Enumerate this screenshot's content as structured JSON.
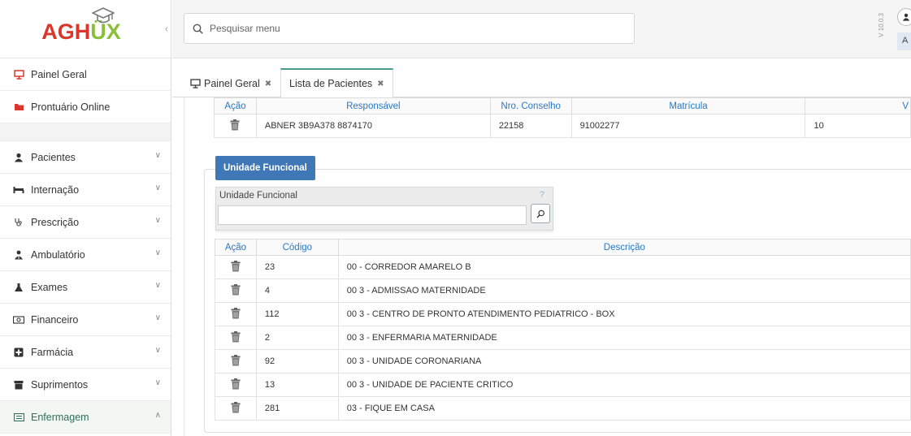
{
  "app": {
    "logo_text_a": "AGH",
    "logo_text_ux": "ÜX"
  },
  "sidebar": {
    "collapse_icon": "chevron-left-icon",
    "top_items": [
      {
        "label": "Painel Geral",
        "icon": "monitor-icon",
        "color": "#d9372b"
      },
      {
        "label": "Prontuário Online",
        "icon": "folder-icon",
        "color": "#d9372b"
      }
    ],
    "items": [
      {
        "label": "Pacientes",
        "icon": "user-icon"
      },
      {
        "label": "Internação",
        "icon": "bed-icon"
      },
      {
        "label": "Prescrição",
        "icon": "stethoscope-icon"
      },
      {
        "label": "Ambulatório",
        "icon": "doctor-icon"
      },
      {
        "label": "Exames",
        "icon": "flask-icon"
      },
      {
        "label": "Financeiro",
        "icon": "money-icon"
      },
      {
        "label": "Farmácia",
        "icon": "pharmacy-icon"
      },
      {
        "label": "Suprimentos",
        "icon": "box-icon"
      },
      {
        "label": "Enfermagem",
        "icon": "card-icon",
        "active": true
      }
    ]
  },
  "topbar": {
    "search_placeholder": "Pesquisar menu",
    "version": "V 10.0.3",
    "user_initial": "A"
  },
  "tabs": [
    {
      "label": "Painel Geral",
      "icon": "monitor-icon",
      "active": false
    },
    {
      "label": "Lista de Pacientes",
      "active": true
    }
  ],
  "responsavel_table": {
    "headers": [
      "Ação",
      "Responsável",
      "Nro. Conselho",
      "Matrícula",
      "V"
    ],
    "rows": [
      {
        "responsavel": "ABNER 3B9A378 8874170",
        "conselho": "22158",
        "matricula": "91002277",
        "v": "10"
      }
    ]
  },
  "unidade_funcional": {
    "legend": "Unidade Funcional",
    "field_label": "Unidade Funcional",
    "help": "?",
    "value": "",
    "headers": [
      "Ação",
      "Código",
      "Descrição"
    ],
    "rows": [
      {
        "codigo": "23",
        "descricao": "00 - CORREDOR AMARELO B"
      },
      {
        "codigo": "4",
        "descricao": "00 3 - ADMISSAO MATERNIDADE"
      },
      {
        "codigo": "112",
        "descricao": "00 3 - CENTRO DE PRONTO ATENDIMENTO PEDIATRICO - BOX"
      },
      {
        "codigo": "2",
        "descricao": "00 3 - ENFERMARIA MATERNIDADE"
      },
      {
        "codigo": "92",
        "descricao": "00 3 - UNIDADE CORONARIANA"
      },
      {
        "codigo": "13",
        "descricao": "00 3 - UNIDADE DE PACIENTE CRITICO"
      },
      {
        "codigo": "281",
        "descricao": "03 - FIQUE EM CASA"
      }
    ]
  }
}
